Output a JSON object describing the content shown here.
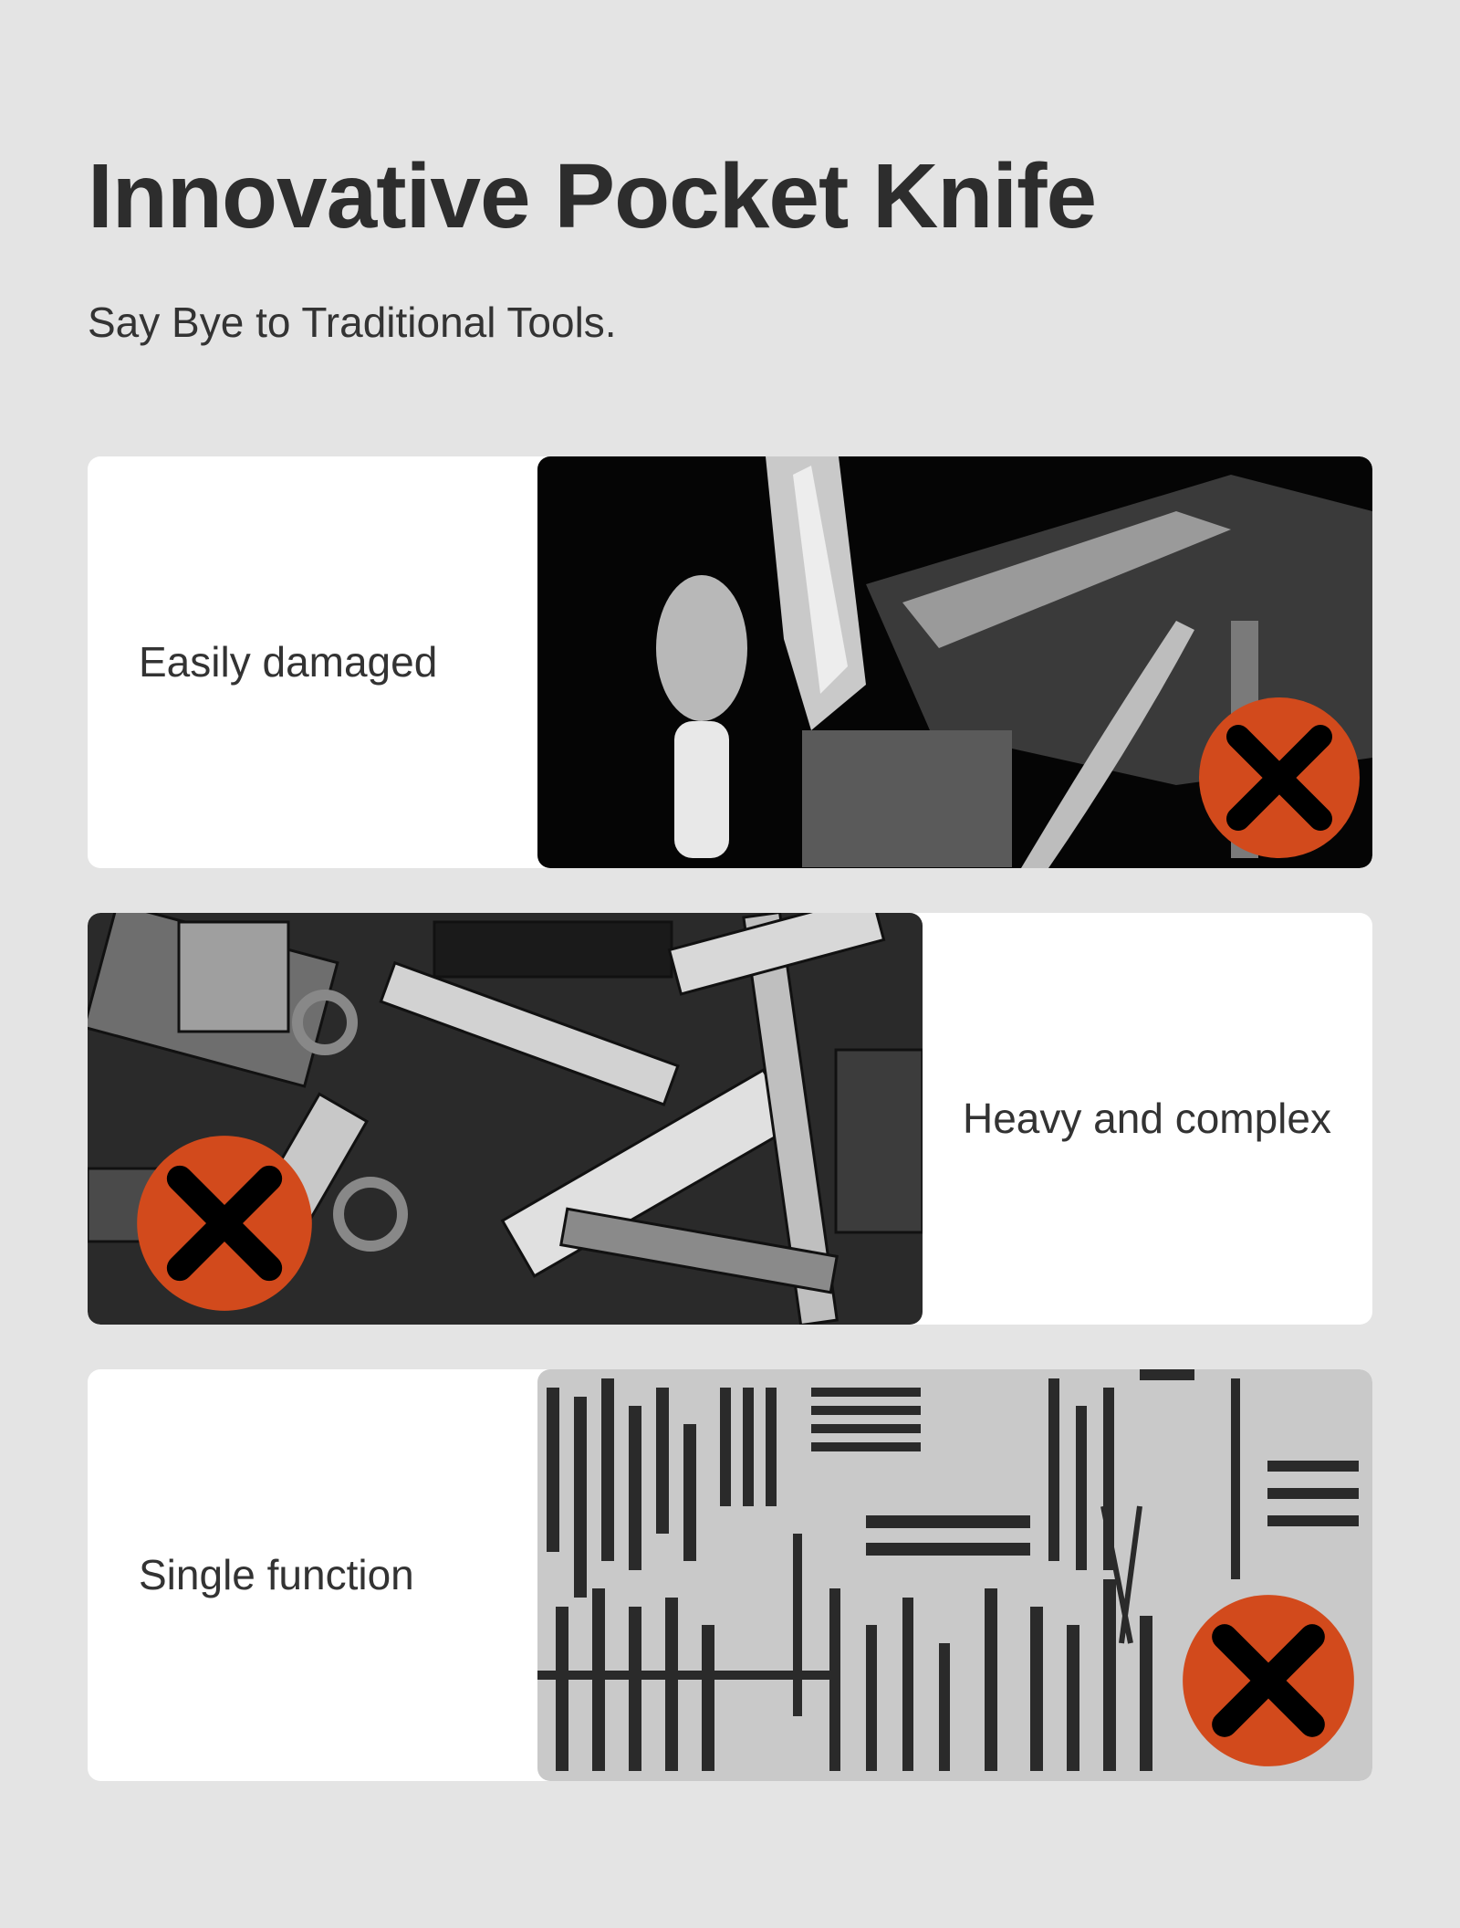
{
  "header": {
    "title": "Innovative Pocket Knife",
    "subtitle": "Say Bye to Traditional Tools."
  },
  "items": [
    {
      "label": "Easily damaged",
      "image": "shaving-brush-razor-axe-photo",
      "status_icon": "x-mark-icon"
    },
    {
      "label": "Heavy and complex",
      "image": "pile-of-tools-photo",
      "status_icon": "x-mark-icon"
    },
    {
      "label": "Single function",
      "image": "tool-wall-photo",
      "status_icon": "x-mark-icon"
    }
  ],
  "colors": {
    "background": "#e4e4e4",
    "card": "#ffffff",
    "x_badge": "#d24a1c",
    "x_stroke": "#000000"
  }
}
